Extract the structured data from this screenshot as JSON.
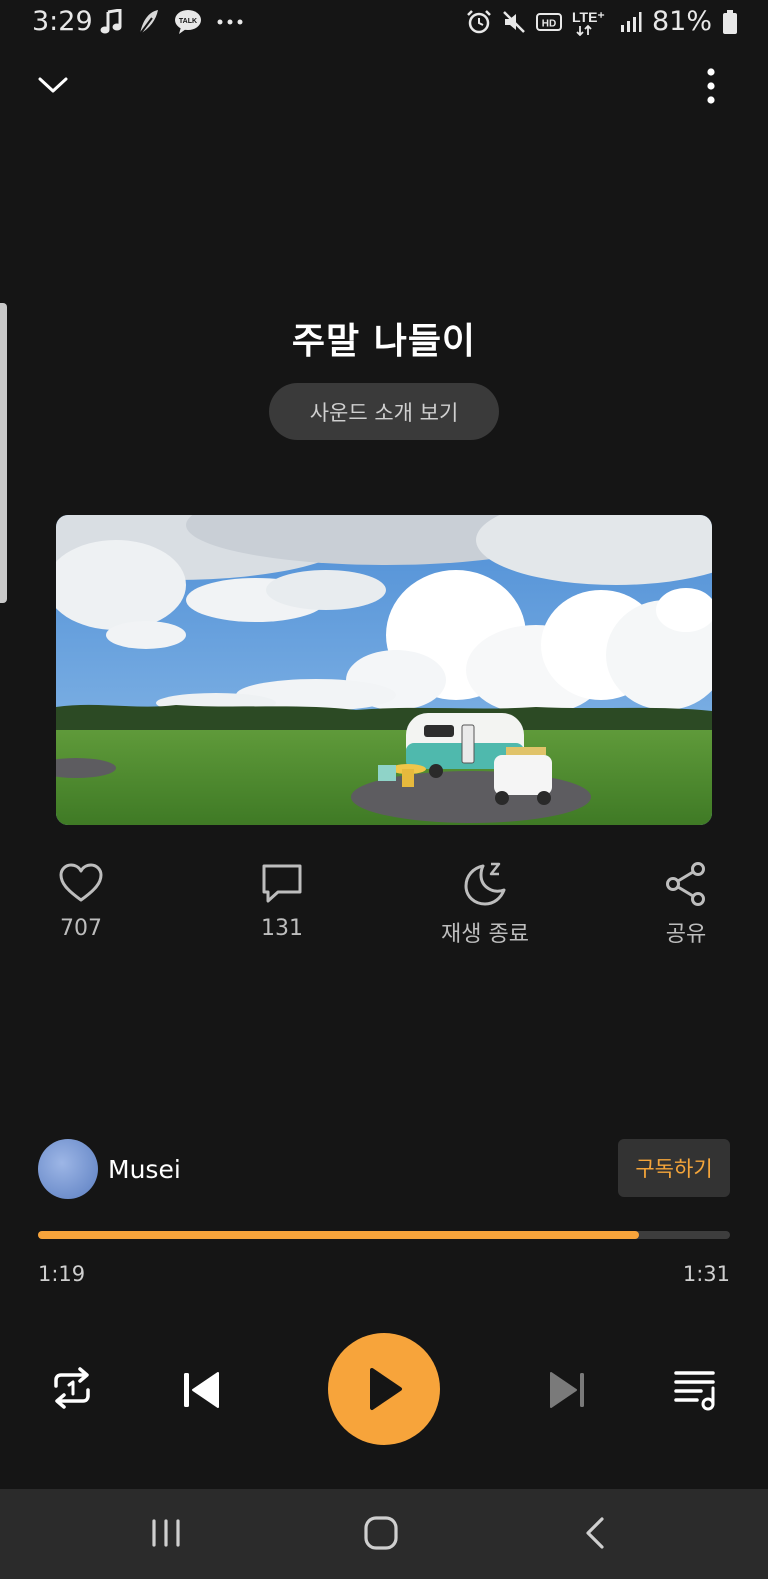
{
  "status_bar": {
    "time": "3:29",
    "battery": "81%",
    "left_icons": [
      "music-note-icon",
      "feather-icon",
      "kakaotalk-icon",
      "more-dots-icon"
    ],
    "right_icons": [
      "alarm-icon",
      "mute-icon",
      "hd-icon",
      "lte-icon",
      "signal-icon",
      "battery-icon"
    ],
    "network_label": "LTE⁺",
    "hd_label": "HD",
    "talk_label": "TALK"
  },
  "player": {
    "title": "주말 나들이",
    "intro_button": "사운드 소개 보기",
    "actions": {
      "like_count": "707",
      "comment_count": "131",
      "sleep_label": "재생 종료",
      "share_label": "공유"
    },
    "creator": {
      "name": "Musei",
      "subscribe_label": "구독하기"
    },
    "progress": {
      "current": "1:19",
      "total": "1:31",
      "fraction": 0.868
    }
  },
  "colors": {
    "accent": "#f7a43b",
    "background": "#151515",
    "navbar": "#2b2b2b"
  }
}
